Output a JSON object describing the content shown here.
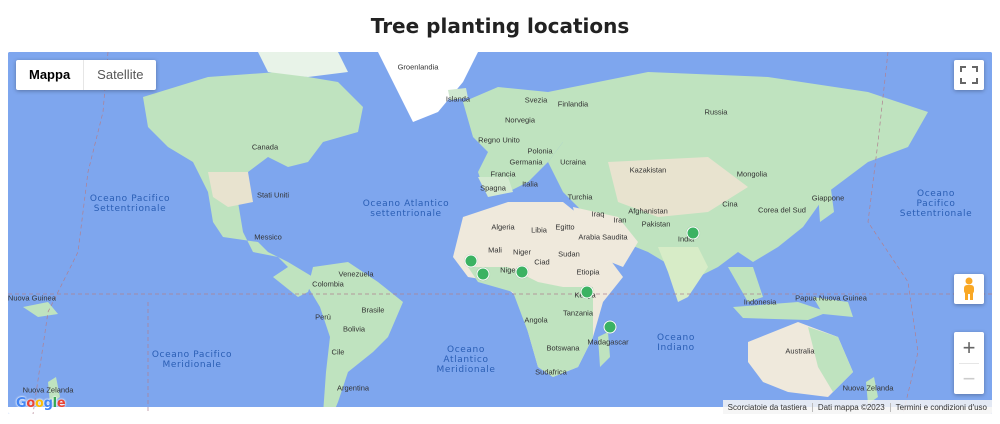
{
  "page": {
    "title": "Tree planting locations"
  },
  "map_type": {
    "options": [
      "Mappa",
      "Satellite"
    ],
    "selected": "Mappa"
  },
  "oceans": [
    "Oceano Pacifico\nSettentrionale",
    "Oceano Atlantico\nsettentrionale",
    "Oceano Pacifico\nSettentrionale",
    "Oceano Pacifico\nMeridionale",
    "Oceano\nAtlantico\nMeridionale",
    "Oceano\nIndiano"
  ],
  "labels": [
    "Groenlandia",
    "Islanda",
    "Svezia",
    "Finlandia",
    "Norvegia",
    "Russia",
    "Regno Unito",
    "Polonia",
    "Germania",
    "Ucraina",
    "Francia",
    "Kazakistan",
    "Mongolia",
    "Spagna",
    "Italia",
    "Turchia",
    "Canada",
    "Stati Uniti",
    "Messico",
    "Algeria",
    "Libia",
    "Egitto",
    "Iraq",
    "Afghanistan",
    "Pakistan",
    "Iran",
    "Arabia Saudita",
    "Cina",
    "Corea del Sud",
    "Giappone",
    "India",
    "Mali",
    "Niger",
    "Sudan",
    "Ciad",
    "Etiopia",
    "Venezuela",
    "Colombia",
    "Perù",
    "Brasile",
    "Bolivia",
    "Argentina",
    "Angola",
    "Tanzania",
    "Kenya",
    "Botswana",
    "Madagascar",
    "Sudafrica",
    "Indonesia",
    "Papua Nuova Guinea",
    "Papua Nuova Guinea",
    "Australia",
    "Nuova Zelanda",
    "Nuova Zelanda",
    "Cile",
    "Nigeria"
  ],
  "locations": [
    {
      "name": "Senegal",
      "lat": 14.5,
      "lon": -14.5
    },
    {
      "name": "Liberia",
      "lat": 8.0,
      "lon": -9.5
    },
    {
      "name": "Nigeria",
      "lat": 9.0,
      "lon": 8.0
    },
    {
      "name": "Nepal",
      "lat": 28.3,
      "lon": 84.0
    },
    {
      "name": "Kenya",
      "lat": -1.0,
      "lon": 37.0
    },
    {
      "name": "Madagascar",
      "lat": -18.5,
      "lon": 47.0
    }
  ],
  "controls": {
    "zoom_in": "+",
    "zoom_out": "−"
  },
  "attribution": {
    "logo": "Google",
    "shortcuts": "Scorciatoie da tastiera",
    "data": "Dati mappa ©2023",
    "terms": "Termini e condizioni d'uso"
  },
  "colors": {
    "water": "#7ea6ee",
    "land": "#bfe3bf",
    "desert": "#efe9dc",
    "ice": "#ffffff",
    "marker": "#3bb262"
  },
  "icons": [
    "fullscreen-icon",
    "pegman-icon",
    "zoom-in-icon",
    "zoom-out-icon"
  ]
}
